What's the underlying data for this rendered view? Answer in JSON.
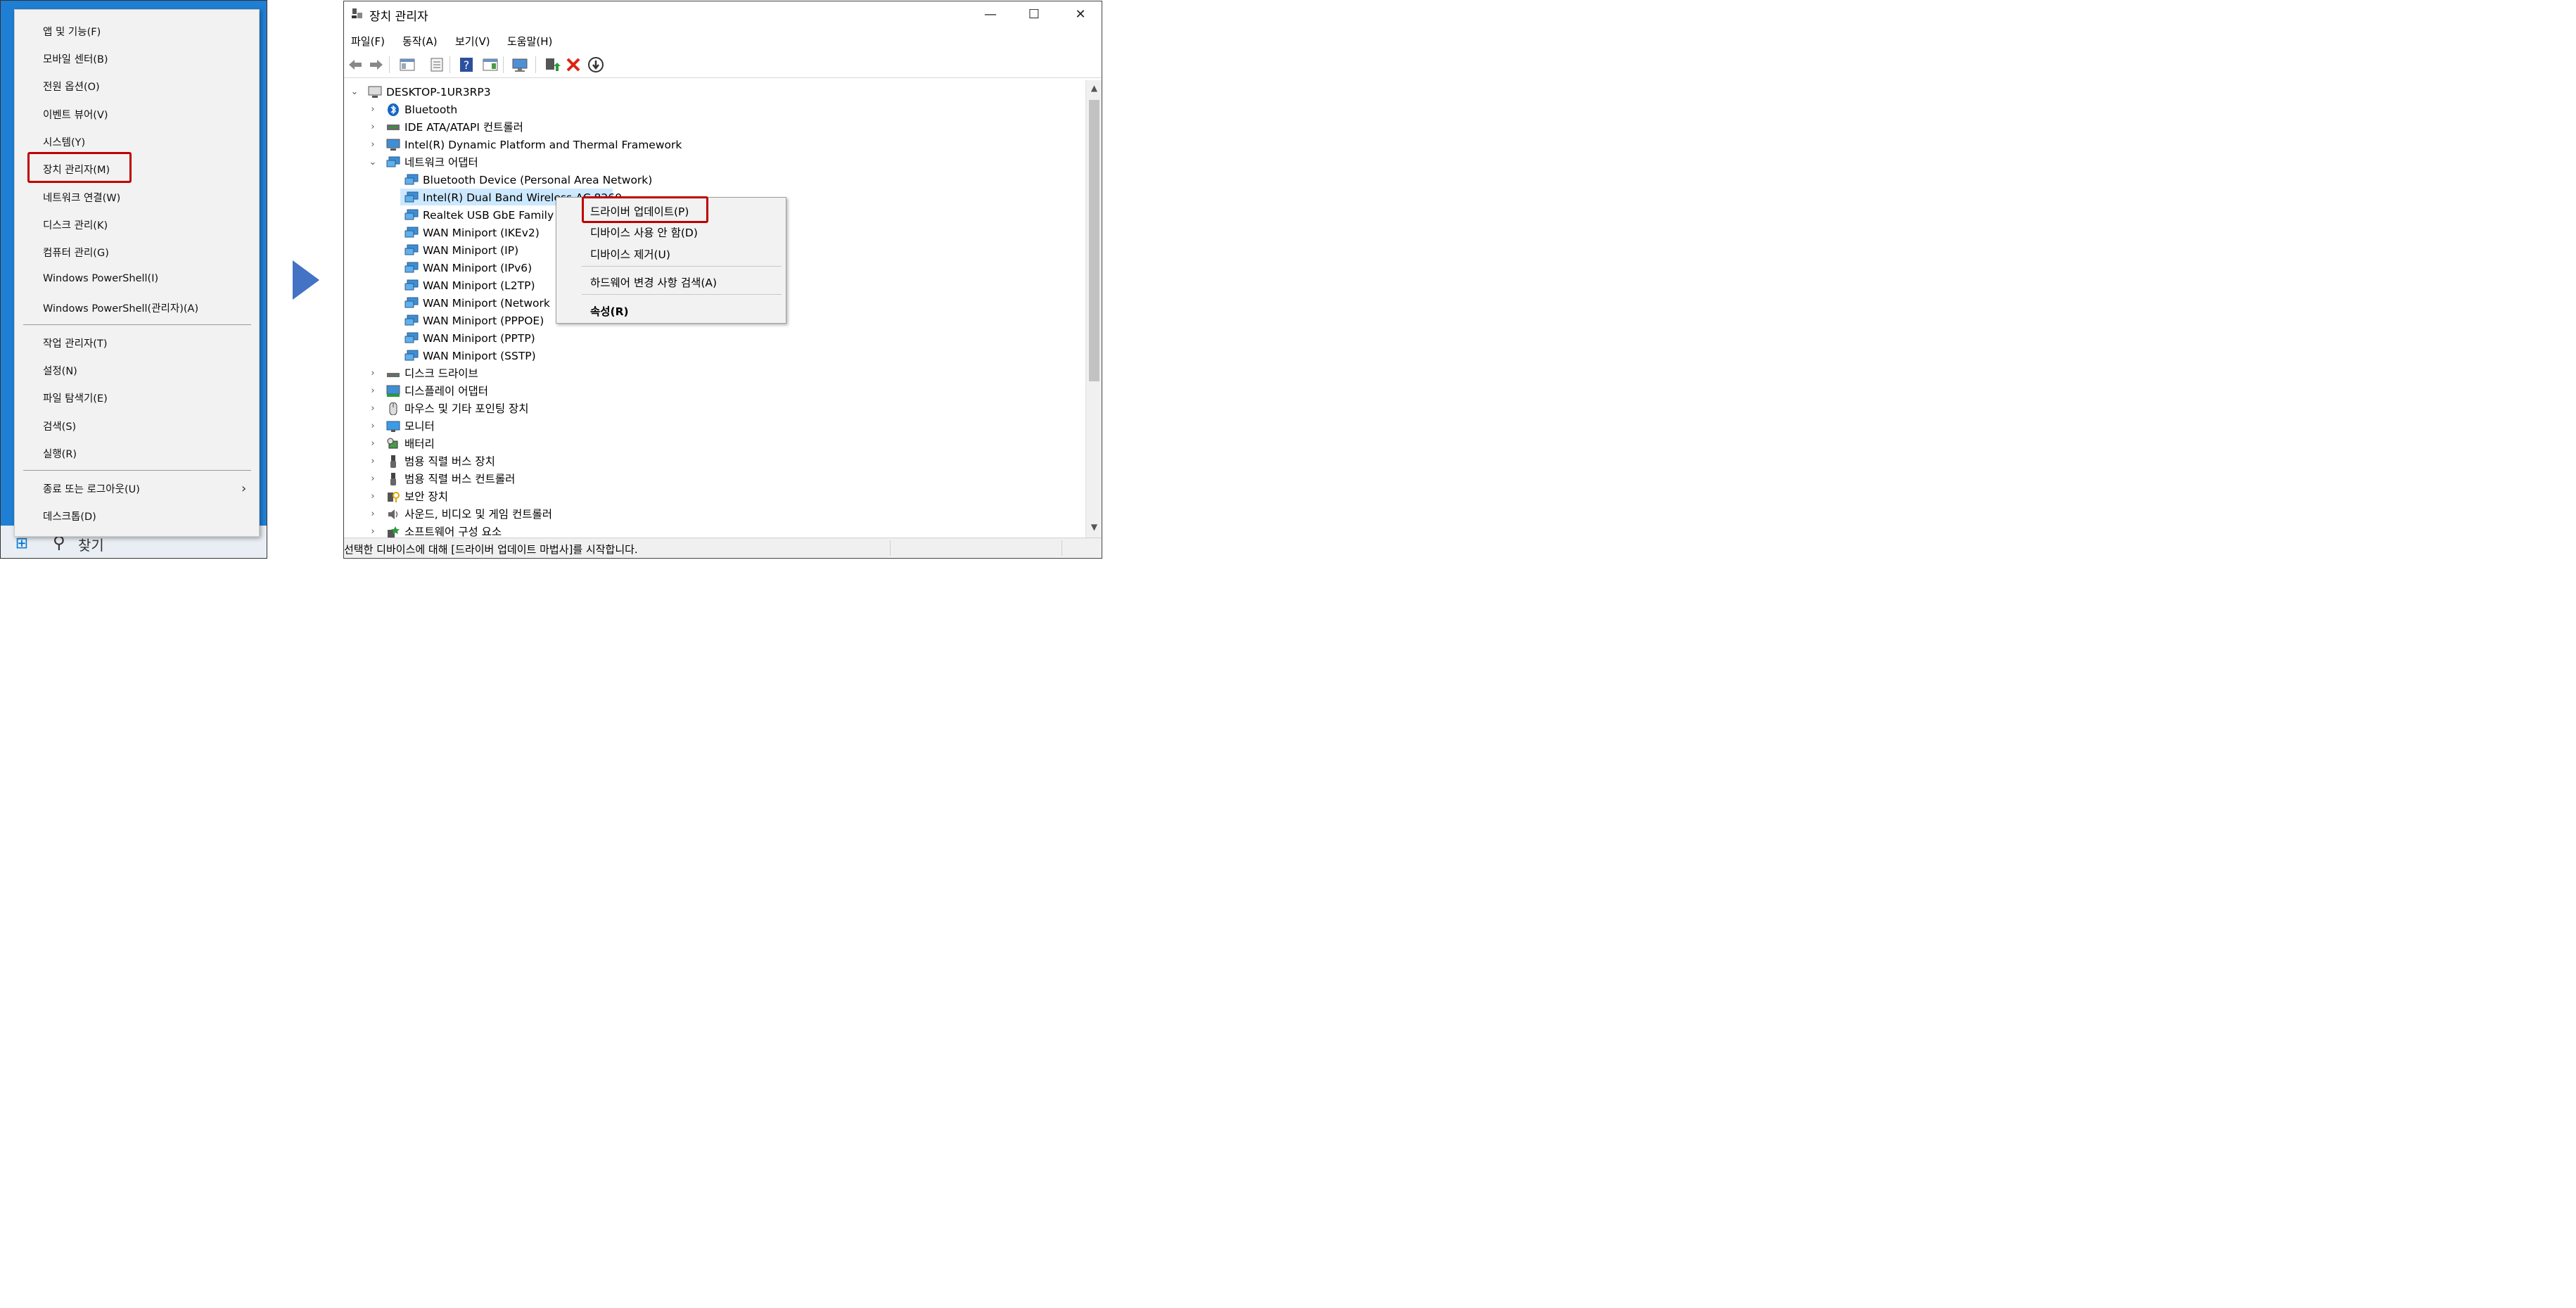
{
  "left": {
    "menu_items": [
      {
        "label": "앱 및 기능(F)"
      },
      {
        "label": "모바일 센터(B)"
      },
      {
        "label": "전원 옵션(O)"
      },
      {
        "label": "이벤트 뷰어(V)"
      },
      {
        "label": "시스템(Y)"
      },
      {
        "label": "장치 관리자(M)"
      },
      {
        "label": "네트워크 연결(W)"
      },
      {
        "label": "디스크 관리(K)"
      },
      {
        "label": "컴퓨터 관리(G)"
      },
      {
        "label": "Windows PowerShell(I)"
      },
      {
        "label": "Windows PowerShell(관리자)(A)"
      },
      {
        "label": "작업 관리자(T)"
      },
      {
        "label": "설정(N)"
      },
      {
        "label": "파일 탐색기(E)"
      },
      {
        "label": "검색(S)"
      },
      {
        "label": "실행(R)"
      },
      {
        "label": "종료 또는 로그아웃(U)"
      },
      {
        "label": "데스크톱(D)"
      }
    ],
    "highlighted_item": "장치 관리자(M)",
    "taskbar_search": "찾기"
  },
  "window": {
    "title": "장치 관리자",
    "minimize": "—",
    "maximize": "☐",
    "close": "✕",
    "menus": [
      "파일(F)",
      "동작(A)",
      "보기(V)",
      "도움말(H)"
    ]
  },
  "tree": {
    "root": "DESKTOP-1UR3RP3",
    "items": [
      {
        "label": "Bluetooth",
        "icon": "bluetooth-icon",
        "expanded": false
      },
      {
        "label": "IDE ATA/ATAPI 컨트롤러",
        "icon": "ide-controller-icon",
        "expanded": false
      },
      {
        "label": "Intel(R) Dynamic Platform and Thermal Framework",
        "icon": "intel-thermal-icon",
        "expanded": false
      },
      {
        "label": "네트워크 어댑터",
        "icon": "network-adapter-icon",
        "expanded": true
      }
    ],
    "network_children": [
      "Bluetooth Device (Personal Area Network)",
      "Intel(R) Dual Band Wireless-AC 8260",
      "Realtek USB GbE Family C",
      "WAN Miniport (IKEv2)",
      "WAN Miniport (IP)",
      "WAN Miniport (IPv6)",
      "WAN Miniport (L2TP)",
      "WAN Miniport (Network",
      "WAN Miniport (PPPOE)",
      "WAN Miniport (PPTP)",
      "WAN Miniport (SSTP)"
    ],
    "selected_child": "Intel(R) Dual Band Wireless-AC 8260",
    "after_items": [
      {
        "label": "디스크 드라이브",
        "icon": "disk-drive-icon"
      },
      {
        "label": "디스플레이 어댑터",
        "icon": "display-adapter-icon"
      },
      {
        "label": "마우스 및 기타 포인팅 장치",
        "icon": "mouse-icon"
      },
      {
        "label": "모니터",
        "icon": "monitor-icon"
      },
      {
        "label": "배터리",
        "icon": "battery-icon"
      },
      {
        "label": "범용 직렬 버스 장치",
        "icon": "usb-device-icon"
      },
      {
        "label": "범용 직렬 버스 컨트롤러",
        "icon": "usb-controller-icon"
      },
      {
        "label": "보안 장치",
        "icon": "security-device-icon"
      },
      {
        "label": "사운드, 비디오 및 게임 컨트롤러",
        "icon": "sound-icon"
      },
      {
        "label": "소프트웨어 구성 요소",
        "icon": "software-component-icon"
      }
    ]
  },
  "context_menu": {
    "items": [
      {
        "label": "드라이버 업데이트(P)",
        "bold": false
      },
      {
        "label": "디바이스 사용 안 함(D)",
        "bold": false
      },
      {
        "label": "디바이스 제거(U)",
        "bold": false
      },
      {
        "label": "하드웨어 변경 사항 검색(A)",
        "bold": false
      },
      {
        "label": "속성(R)",
        "bold": true
      }
    ],
    "highlighted_item": "드라이버 업데이트(P)"
  },
  "status": {
    "text": "선택한 디바이스에 대해 [드라이버 업데이트 마법사]를 시작합니다."
  },
  "colors": {
    "highlight_border": "#c00000",
    "selection": "#cce8ff",
    "arrow": "#4472c4",
    "desktop": "#1f7fd4"
  }
}
